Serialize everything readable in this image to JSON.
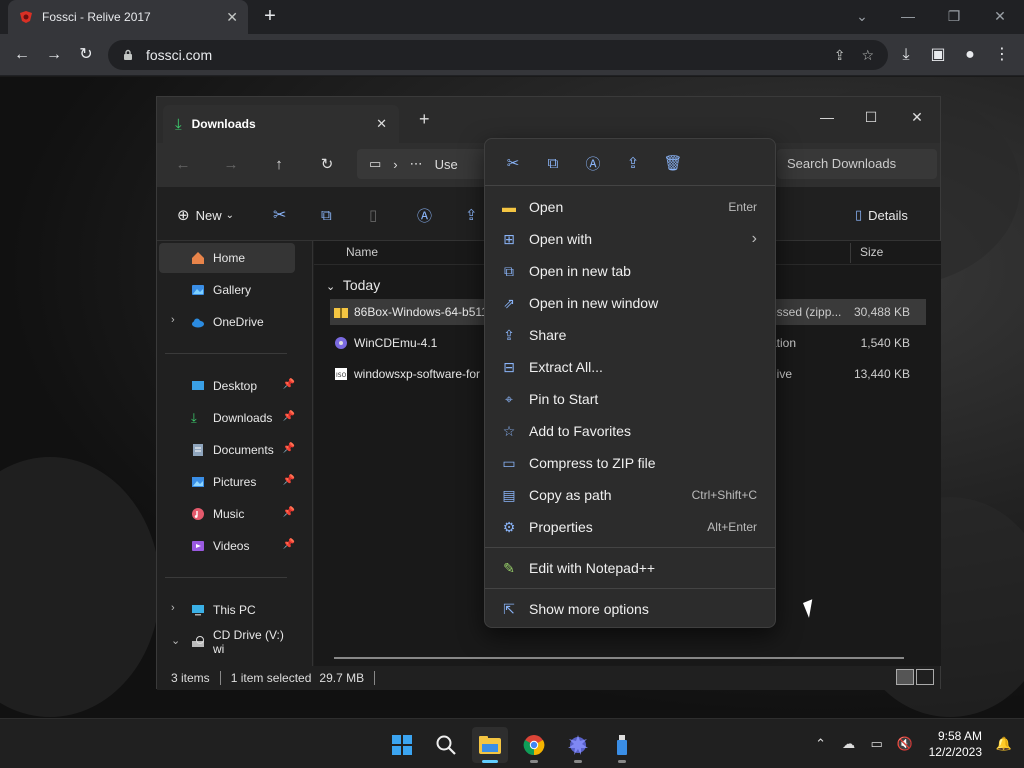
{
  "browser": {
    "tab_title": "Fossci - Relive 2017",
    "url": "fossci.com"
  },
  "explorer": {
    "tab_title": "Downloads",
    "address_segment": "Use",
    "search_placeholder": "Search Downloads",
    "toolbar": {
      "new_label": "New",
      "details_label": "Details"
    },
    "nav": {
      "home": "Home",
      "gallery": "Gallery",
      "onedrive": "OneDrive",
      "desktop": "Desktop",
      "downloads": "Downloads",
      "documents": "Documents",
      "pictures": "Pictures",
      "music": "Music",
      "videos": "Videos",
      "this_pc": "This PC",
      "cd_drive": "CD Drive (V:) wi"
    },
    "columns": {
      "name": "Name",
      "size": "Size"
    },
    "group_label": "Today",
    "files": [
      {
        "name": "86Box-Windows-64-b511",
        "type": "essed (zipp...",
        "size": "30,488 KB"
      },
      {
        "name": "WinCDEmu-4.1",
        "type": "ation",
        "size": "1,540 KB"
      },
      {
        "name": "windowsxp-software-for",
        "type": "hive",
        "size": "13,440 KB"
      }
    ],
    "status": {
      "items": "3 items",
      "selected": "1 item selected",
      "size": "29.7 MB"
    }
  },
  "context_menu": {
    "items": [
      {
        "label": "Open",
        "shortcut": "Enter"
      },
      {
        "label": "Open with",
        "shortcut": ""
      },
      {
        "label": "Open in new tab",
        "shortcut": ""
      },
      {
        "label": "Open in new window",
        "shortcut": ""
      },
      {
        "label": "Share",
        "shortcut": ""
      },
      {
        "label": "Extract All...",
        "shortcut": ""
      },
      {
        "label": "Pin to Start",
        "shortcut": ""
      },
      {
        "label": "Add to Favorites",
        "shortcut": ""
      },
      {
        "label": "Compress to ZIP file",
        "shortcut": ""
      },
      {
        "label": "Copy as path",
        "shortcut": "Ctrl+Shift+C"
      },
      {
        "label": "Properties",
        "shortcut": "Alt+Enter"
      },
      {
        "label": "Edit with Notepad++",
        "shortcut": ""
      },
      {
        "label": "Show more options",
        "shortcut": ""
      }
    ]
  },
  "taskbar": {
    "time": "9:58 AM",
    "date": "12/2/2023"
  },
  "colors": {
    "accent": "#60cdff",
    "folder": "#f4c542",
    "context_icon": "#8ab4f8"
  }
}
